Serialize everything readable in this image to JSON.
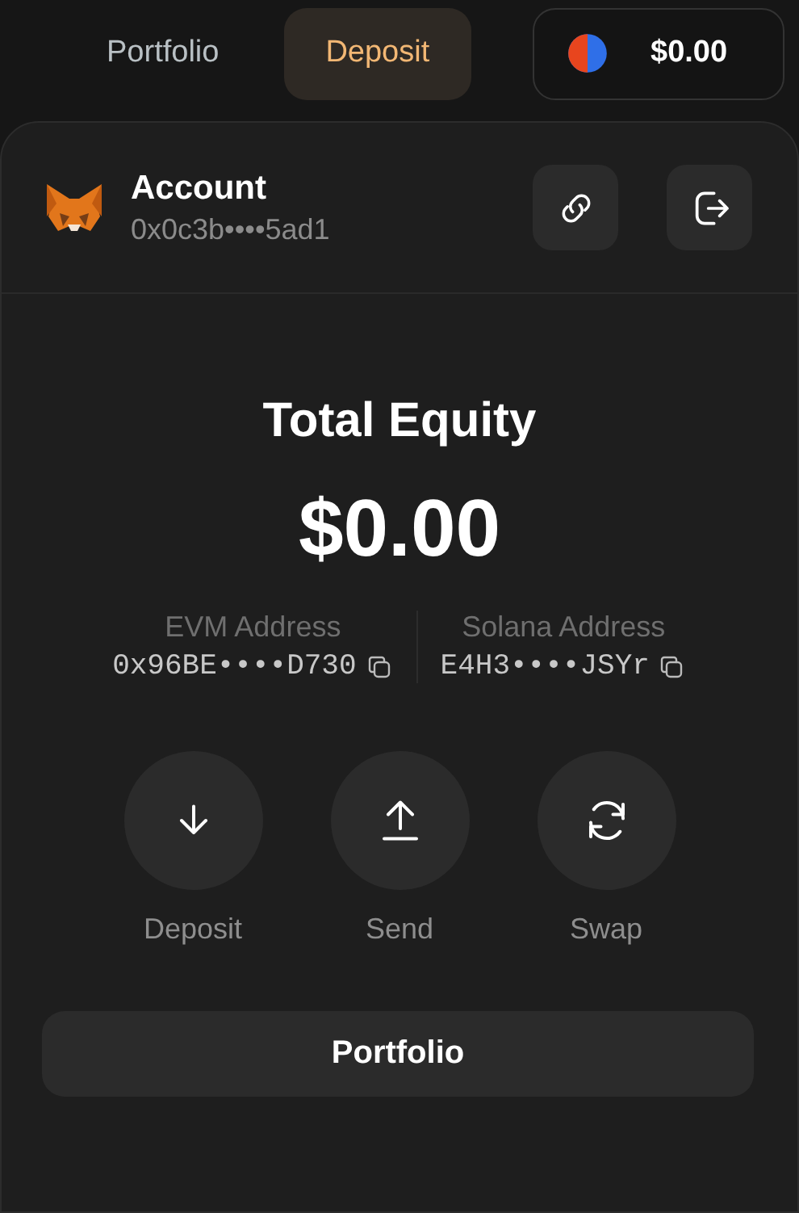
{
  "nav": {
    "tabs": [
      {
        "label": "Portfolio",
        "selected": false
      },
      {
        "label": "Deposit",
        "selected": true
      }
    ],
    "balance": "$0.00"
  },
  "account": {
    "name": "Account",
    "address": "0x0c3b••••5ad1"
  },
  "equity": {
    "title": "Total Equity",
    "value": "$0.00"
  },
  "addresses": [
    {
      "label": "EVM Address",
      "value": "0x96BE••••D730"
    },
    {
      "label": "Solana Address",
      "value": "E4H3••••JSYr"
    }
  ],
  "actions": [
    {
      "kind": "deposit",
      "label": "Deposit"
    },
    {
      "kind": "send",
      "label": "Send"
    },
    {
      "kind": "swap",
      "label": "Swap"
    }
  ],
  "portfolio_button": "Portfolio"
}
